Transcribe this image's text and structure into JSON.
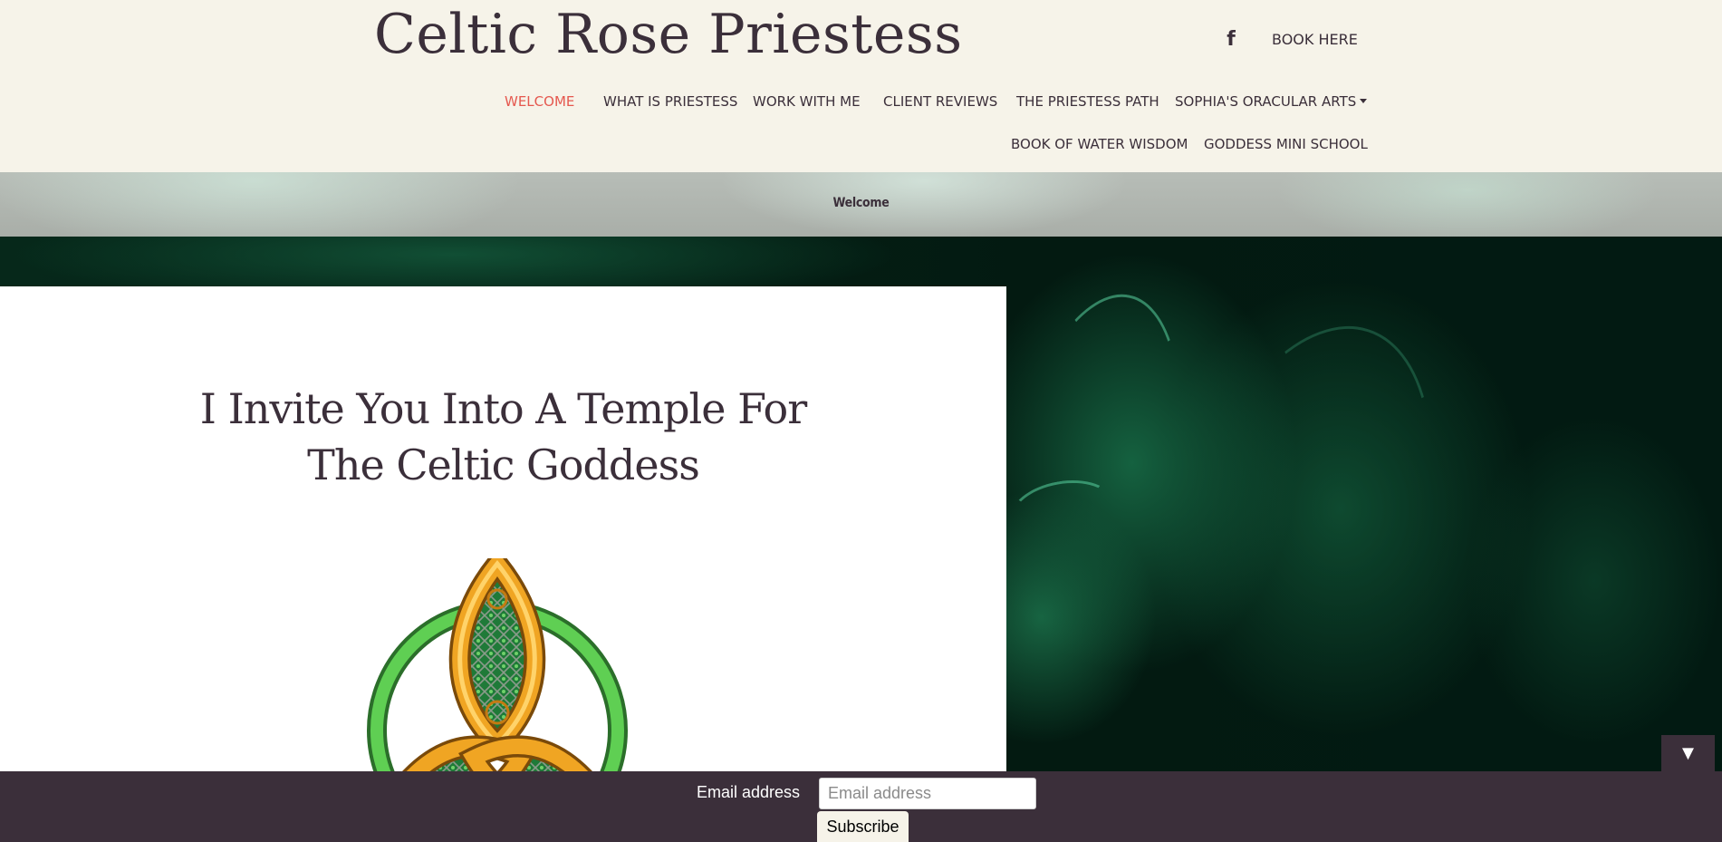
{
  "header": {
    "site_title": "Celtic Rose Priestess",
    "book_here": "BOOK HERE",
    "facebook_icon": "facebook-icon"
  },
  "nav": {
    "row1": [
      {
        "label": "WELCOME",
        "active": true
      },
      {
        "label": "WHAT IS PRIESTESS",
        "active": false
      },
      {
        "label": "WORK WITH ME",
        "active": false
      },
      {
        "label": "CLIENT REVIEWS",
        "active": false
      },
      {
        "label": "THE PRIESTESS PATH",
        "active": false
      },
      {
        "label": "SOPHIA'S ORACULAR ARTS",
        "active": false,
        "has_dropdown": true
      }
    ],
    "row2": [
      {
        "label": "BOOK OF WATER WISDOM",
        "active": false
      },
      {
        "label": "GODDESS MINI SCHOOL",
        "active": false
      }
    ],
    "active_color": "#e5584f",
    "text_color": "#3b2f3a"
  },
  "breadcrumb": {
    "current": "Welcome"
  },
  "main": {
    "heading_line1": "I Invite You Into A Temple For",
    "heading_line2": "The Celtic Goddess",
    "image_icon": "celtic-triquetra-knot"
  },
  "scroll_toggle": {
    "icon": "triangle-down-icon",
    "glyph": "▼"
  },
  "subscribe": {
    "label": "Email address",
    "placeholder": "Email address",
    "value": "",
    "button_label": "Subscribe"
  },
  "colors": {
    "header_bg": "#f6f3e9",
    "brand_dark": "#3b2f3a",
    "hero_green": "#062a1a"
  }
}
